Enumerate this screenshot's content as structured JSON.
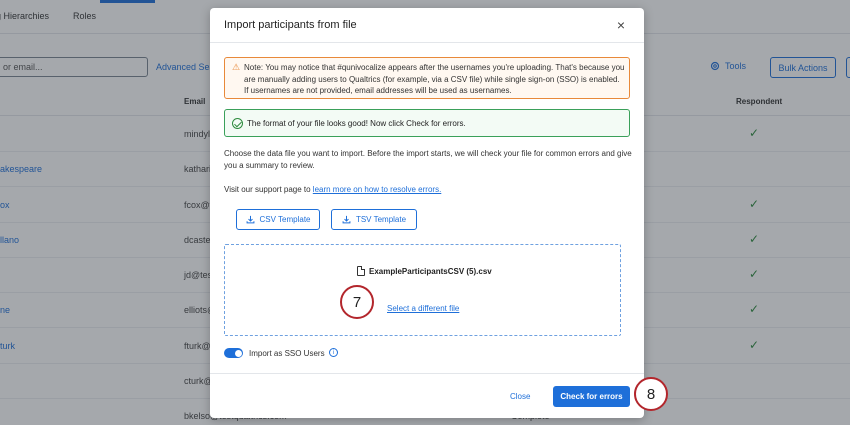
{
  "background": {
    "tabs": [
      "g Hierarchies",
      "Roles"
    ],
    "search_placeholder": "or email...",
    "advanced_search": "Advanced Sear",
    "tools": "Tools",
    "bulk_actions": "Bulk Actions",
    "columns": {
      "email": "Email",
      "respondent": "Respondent"
    },
    "rows": [
      {
        "name": "",
        "email": "mindyl",
        "respondent": "✓",
        "status": ""
      },
      {
        "name": "akespeare",
        "email": "katharir",
        "respondent": "",
        "status": ""
      },
      {
        "name": "ox",
        "email": "fcox@te",
        "respondent": "✓",
        "status": ""
      },
      {
        "name": "llano",
        "email": "dcastell",
        "respondent": "✓",
        "status": ""
      },
      {
        "name": "",
        "email": "jd@test",
        "respondent": "✓",
        "status": ""
      },
      {
        "name": "ne",
        "email": "elliots@",
        "respondent": "✓",
        "status": ""
      },
      {
        "name": "turk",
        "email": "fturk@t",
        "respondent": "✓",
        "status": ""
      },
      {
        "name": "",
        "email": "cturk@",
        "respondent": "",
        "status": ""
      },
      {
        "name": "",
        "email": "bkelso@testqualtrics.com",
        "respondent": "",
        "status": "Complete"
      }
    ]
  },
  "modal": {
    "title": "Import participants from file",
    "close_icon": "×",
    "warning_icon": "⚠",
    "warning_text": "Note: You may notice that #qunivocalize appears after the usernames you're uploading. That's because you are manually adding users to Qualtrics (for example, via a CSV file) while single sign-on (SSO) is enabled. If usernames are not provided, email addresses will be used as usernames.",
    "success_text": "The format of your file looks good! Now click Check for errors.",
    "description": "Choose the data file you want to import. Before the import starts, we will check your file for common errors and give you a summary to review.",
    "visit_prefix": "Visit our support page to ",
    "visit_link": "learn more on how to resolve errors.",
    "csv_template": "CSV Template",
    "tsv_template": "TSV Template",
    "file_name": "ExampleParticipantsCSV (5).csv",
    "select_different": "Select a different file",
    "sso_label": "Import as SSO Users",
    "sso_enabled": true,
    "info_icon": "i",
    "close_button": "Close",
    "check_button": "Check for errors"
  },
  "steps": {
    "step7": "7",
    "step8": "8"
  },
  "colors": {
    "accent": "#1e6fd9",
    "warning": "#e8893a",
    "success": "#3aa05a",
    "step_ring": "#b3262c"
  }
}
